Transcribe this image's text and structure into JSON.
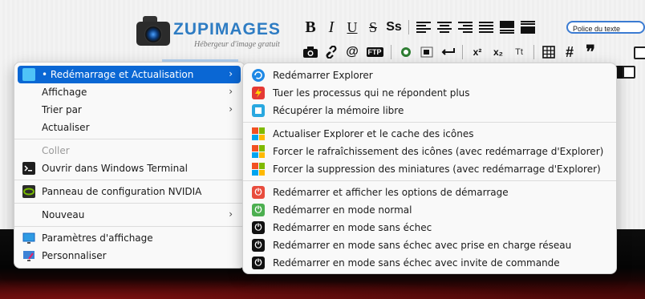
{
  "website": {
    "logo_title": "ZUPIMAGES",
    "logo_subtitle": "Hébergeur d'image gratuit",
    "font_select_value": "Police du texte",
    "toolbar_row1": [
      "B",
      "I",
      "U",
      "S",
      "Ss"
    ],
    "toolbar_row2_text": [
      "@",
      "FTP",
      "x²",
      "x₂",
      "Tt",
      "#",
      "❞"
    ]
  },
  "context_menu": {
    "items": [
      {
        "label": "• Redémarrage et Actualisation",
        "icon": "folder-icon",
        "has_submenu": true,
        "selected": true
      },
      {
        "label": "Affichage",
        "has_submenu": true
      },
      {
        "label": "Trier par",
        "has_submenu": true
      },
      {
        "label": "Actualiser"
      },
      {
        "label": "Coller",
        "disabled": true
      },
      {
        "label": "Ouvrir dans Windows Terminal",
        "icon": "terminal-icon"
      },
      {
        "label": "Panneau de configuration NVIDIA",
        "icon": "nvidia-icon"
      },
      {
        "label": "Nouveau",
        "has_submenu": true
      },
      {
        "label": "Paramètres d'affichage",
        "icon": "display-settings-icon"
      },
      {
        "label": "Personnaliser",
        "icon": "personalize-icon"
      }
    ]
  },
  "submenu": {
    "items": [
      {
        "label": "Redémarrer Explorer",
        "icon": "refresh-explorer-icon",
        "color": "#1e88e5"
      },
      {
        "label": "Tuer les processus qui ne répondent plus",
        "icon": "lightning-icon",
        "color": "#e53935"
      },
      {
        "label": "Récupérer la mémoire libre",
        "icon": "memory-icon",
        "color": "#29a8e0"
      },
      {
        "label": "Actualiser Explorer et le cache des icônes",
        "icon": "windows-logo-icon"
      },
      {
        "label": "Forcer le rafraîchissement des icônes (avec redémarrage d'Explorer)",
        "icon": "windows-logo-icon"
      },
      {
        "label": "Forcer la suppression des miniatures (avec redémarrage d'Explorer)",
        "icon": "windows-logo-icon"
      },
      {
        "label": "Redémarrer et afficher les options de démarrage",
        "icon": "power-icon",
        "color": "#e84c3d"
      },
      {
        "label": "Redémarrer en mode normal",
        "icon": "power-icon",
        "color": "#4caf50"
      },
      {
        "label": "Redémarrer en mode sans échec",
        "icon": "power-icon",
        "color": "#111111"
      },
      {
        "label": "Redémarrer en mode sans échec avec prise en charge réseau",
        "icon": "power-icon",
        "color": "#111111"
      },
      {
        "label": "Redémarrer en mode sans échec avec invite de commande",
        "icon": "power-icon",
        "color": "#111111"
      }
    ]
  }
}
